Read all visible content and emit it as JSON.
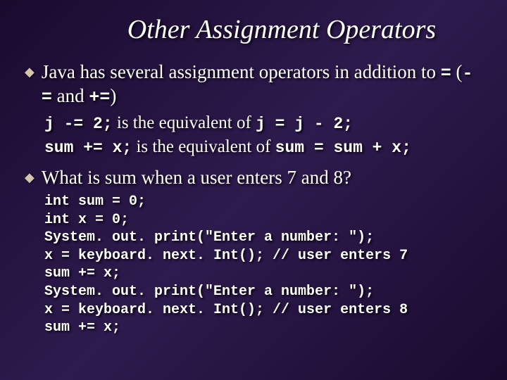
{
  "title": "Other Assignment Operators",
  "bullet1": {
    "pre": "Java has several assignment operators in addition to ",
    "eq": "=",
    "paren_open": " (",
    "minus_eq": "-=",
    "and": " and ",
    "plus_eq": "+=",
    "paren_close": ")"
  },
  "sub1": {
    "code1": "j -= 2;",
    "mid": " is the equivalent of ",
    "code2": "j = j - 2;"
  },
  "sub2": {
    "code1": "sum += x;",
    "mid": " is the equivalent of ",
    "code2": "sum = sum + x;"
  },
  "bullet2": "What is sum when a user enters 7 and 8?",
  "code_lines": [
    "int sum = 0;",
    "int x = 0;",
    "System. out. print(\"Enter a number: \");",
    "x = keyboard. next. Int(); // user enters 7",
    "sum += x;",
    "System. out. print(\"Enter a number: \");",
    "x = keyboard. next. Int(); // user enters 8",
    "sum += x;"
  ]
}
